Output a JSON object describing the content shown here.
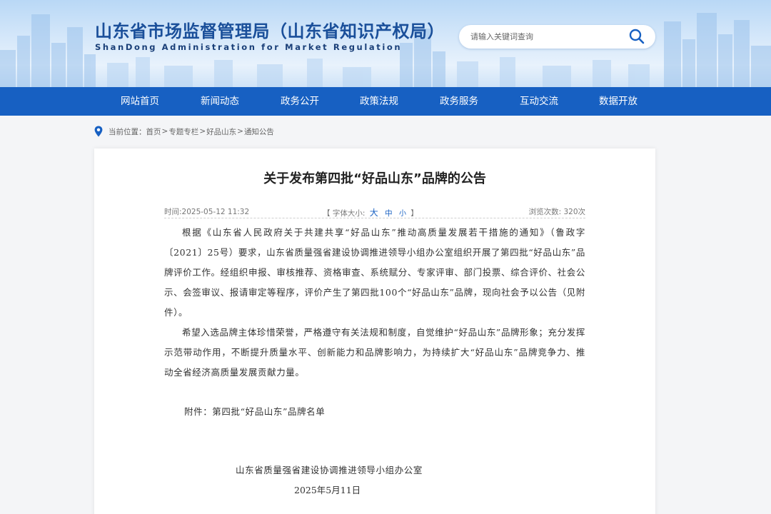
{
  "header": {
    "title": "山东省市场监督管理局（山东省知识产权局）",
    "subtitle": "ShanDong Administration for Market Regulation",
    "search_placeholder": "请输入关键词查询"
  },
  "nav": {
    "items": [
      {
        "label": "网站首页"
      },
      {
        "label": "新闻动态"
      },
      {
        "label": "政务公开"
      },
      {
        "label": "政策法规"
      },
      {
        "label": "政务服务"
      },
      {
        "label": "互动交流"
      },
      {
        "label": "数据开放"
      }
    ]
  },
  "breadcrumb": {
    "prefix": "当前位置：",
    "items": [
      "首页",
      "专题专栏",
      "好品山东",
      "通知公告"
    ],
    "separator": ">"
  },
  "article": {
    "title": "关于发布第四批“好品山东”品牌的公告",
    "time": "时间:2025-05-12 11:32",
    "font_size_label_open": "【 字体大小:",
    "font_size_large": "大",
    "font_size_medium": "中",
    "font_size_small": "小",
    "font_size_label_close": "】",
    "views": "浏览次数: 320次",
    "paragraphs": [
      "根据《山东省人民政府关于共建共享“好品山东”推动高质量发展若干措施的通知》（鲁政字〔2021〕25号）要求，山东省质量强省建设协调推进领导小组办公室组织开展了第四批“好品山东”品牌评价工作。经组织申报、审核推荐、资格审查、系统赋分、专家评审、部门投票、综合评价、社会公示、会签审议、报请审定等程序，评价产生了第四批100个“好品山东”品牌，现向社会予以公告（见附件）。",
      "希望入选品牌主体珍惜荣誉，严格遵守有关法规和制度，自觉维护“好品山东”品牌形象；充分发挥示范带动作用，不断提升质量水平、创新能力和品牌影响力，为持续扩大“好品山东”品牌竞争力、推动全省经济高质量发展贡献力量。"
    ],
    "attachment": "附件：第四批“好品山东”品牌名单",
    "signature_org": "山东省质量强省建设协调推进领导小组办公室",
    "signature_date": "2025年5月11日"
  },
  "colors": {
    "nav_bg": "#1760c2",
    "title_blue": "#1a4f9a",
    "accent": "#1760c2"
  }
}
